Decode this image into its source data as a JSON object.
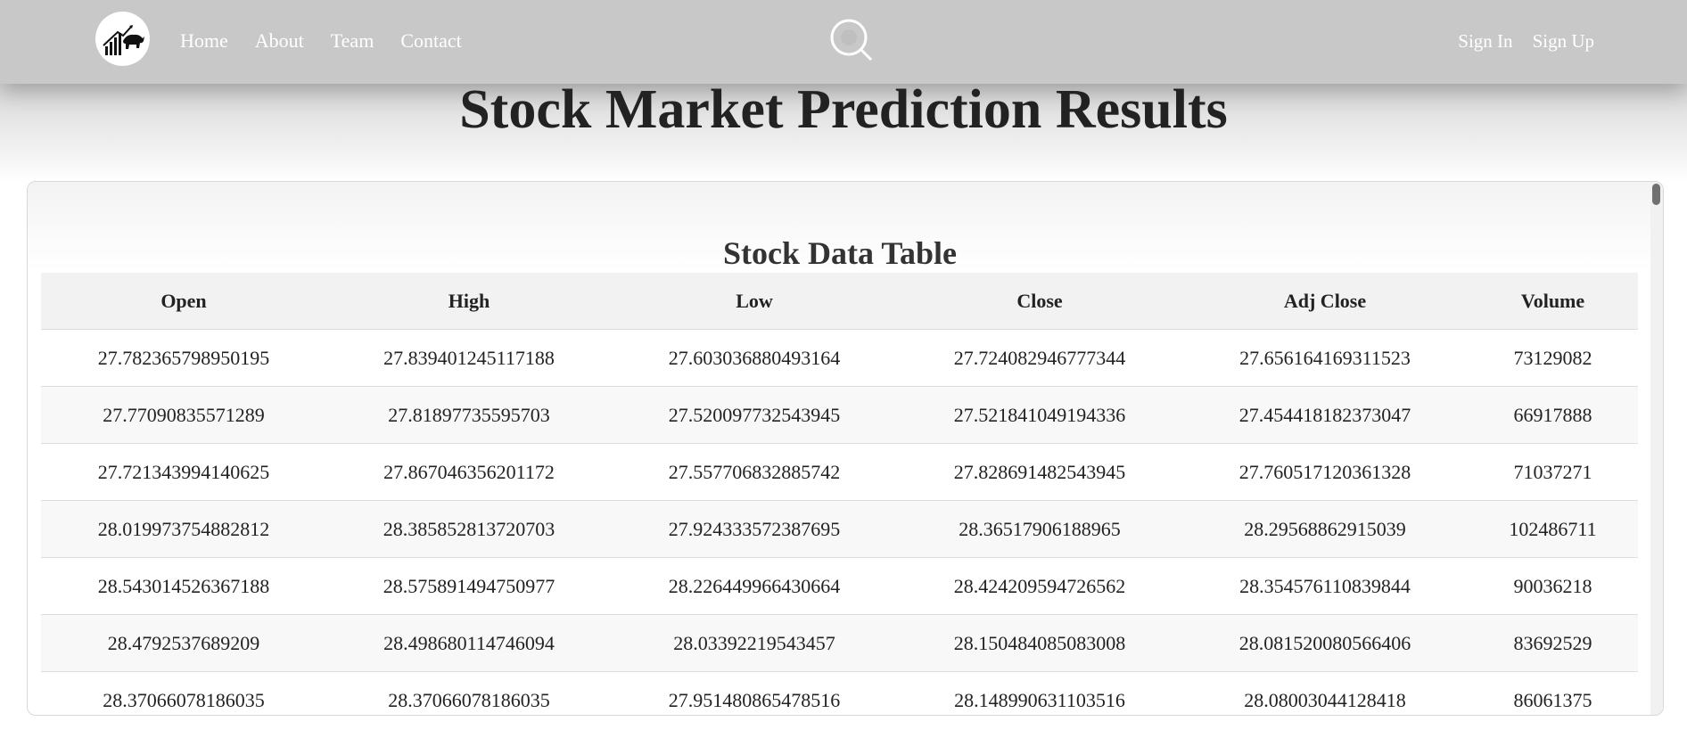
{
  "nav": {
    "logo_icon": "bull-bear-chart-icon",
    "links": [
      "Home",
      "About",
      "Team",
      "Contact"
    ],
    "search_icon": "search-icon",
    "auth": [
      "Sign In",
      "Sign Up"
    ]
  },
  "page": {
    "title": "Stock Market Prediction Results"
  },
  "table": {
    "title": "Stock Data Table",
    "headers": [
      "Open",
      "High",
      "Low",
      "Close",
      "Adj Close",
      "Volume"
    ],
    "rows": [
      [
        "27.782365798950195",
        "27.839401245117188",
        "27.603036880493164",
        "27.724082946777344",
        "27.656164169311523",
        "73129082"
      ],
      [
        "27.77090835571289",
        "27.81897735595703",
        "27.520097732543945",
        "27.521841049194336",
        "27.454418182373047",
        "66917888"
      ],
      [
        "27.721343994140625",
        "27.867046356201172",
        "27.557706832885742",
        "27.828691482543945",
        "27.760517120361328",
        "71037271"
      ],
      [
        "28.019973754882812",
        "28.385852813720703",
        "27.924333572387695",
        "28.36517906188965",
        "28.29568862915039",
        "102486711"
      ],
      [
        "28.543014526367188",
        "28.575891494750977",
        "28.226449966430664",
        "28.424209594726562",
        "28.354576110839844",
        "90036218"
      ],
      [
        "28.4792537689209",
        "28.498680114746094",
        "28.03392219543457",
        "28.150484085083008",
        "28.081520080566406",
        "83692529"
      ],
      [
        "28.37066078186035",
        "28.37066078186035",
        "27.951480865478516",
        "28.148990631103516",
        "28.08003044128418",
        "86061375"
      ]
    ]
  },
  "colors": {
    "navbar": "#c8c8c8",
    "header_row": "#f2f2f2",
    "row_alt": "#f8f8f8",
    "text": "#222222"
  }
}
